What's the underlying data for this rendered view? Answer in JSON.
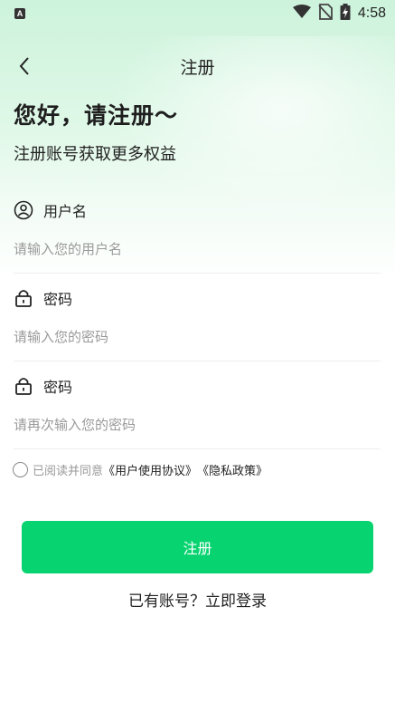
{
  "status_bar": {
    "time": "4:58",
    "app_icon_letter": "A"
  },
  "nav": {
    "title": "注册"
  },
  "header": {
    "headline": "您好，请注册～",
    "subheadline": "注册账号获取更多权益"
  },
  "form": {
    "username": {
      "label": "用户名",
      "placeholder": "请输入您的用户名"
    },
    "password": {
      "label": "密码",
      "placeholder": "请输入您的密码"
    },
    "confirm_password": {
      "label": "密码",
      "placeholder": "请再次输入您的密码"
    }
  },
  "agreement": {
    "prefix": "已阅读并同意",
    "user_agreement": "《用户使用协议》",
    "privacy_policy": "《隐私政策》",
    "checked": false
  },
  "actions": {
    "register_label": "注册",
    "login_prompt": "已有账号？立即登录"
  },
  "colors": {
    "accent": "#07d470",
    "gradient_top": "#cdf3dc"
  }
}
